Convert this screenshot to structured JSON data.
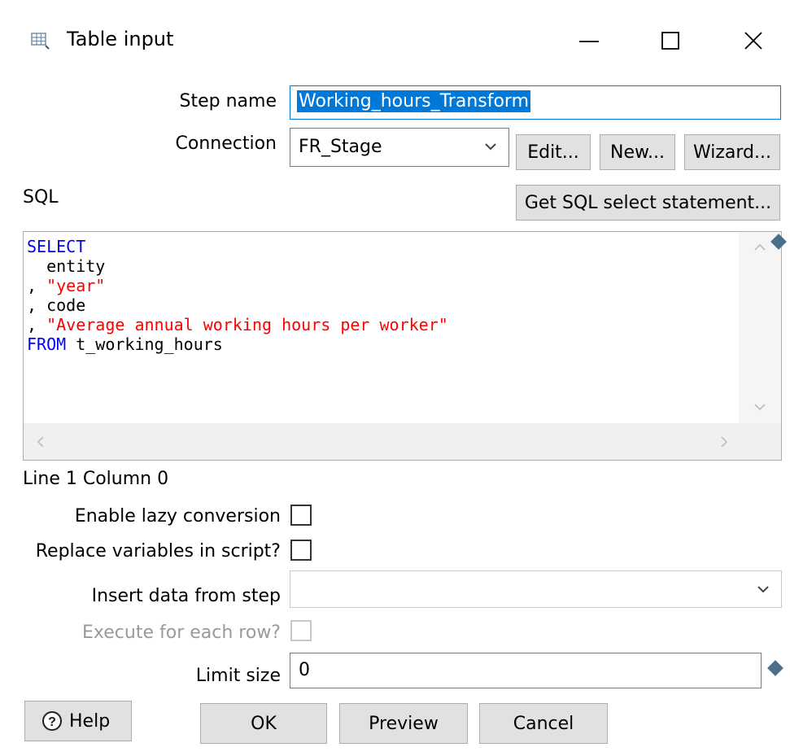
{
  "window": {
    "title": "Table input",
    "minimize_glyph": "—",
    "maximize_glyph": "☐",
    "close_glyph": "✕"
  },
  "step_name": {
    "label": "Step name",
    "value": "Working_hours_Transform"
  },
  "connection": {
    "label": "Connection",
    "value": "FR_Stage"
  },
  "buttons": {
    "edit": "Edit...",
    "new": "New...",
    "wizard": "Wizard...",
    "get_sql": "Get SQL select statement...",
    "help": "Help",
    "ok": "OK",
    "preview": "Preview",
    "cancel": "Cancel"
  },
  "sql": {
    "label": "SQL",
    "lines": [
      {
        "prefix": "",
        "text": "SELECT",
        "kind": "keyword"
      },
      {
        "prefix": "",
        "text": "  entity",
        "kind": "plain"
      },
      {
        "prefix": ",",
        "text": " \"year\"",
        "kind": "string"
      },
      {
        "prefix": ",",
        "text": " code",
        "kind": "plain"
      },
      {
        "prefix": ",",
        "text": " \"Average annual working hours per worker\"",
        "kind": "string"
      },
      {
        "prefix": "",
        "text": "FROM",
        "kind": "keyword",
        "rest": " t_working_hours"
      }
    ]
  },
  "status": "Line 1 Column 0",
  "options": {
    "lazy_conversion": {
      "label": "Enable lazy conversion",
      "checked": false
    },
    "replace_variables": {
      "label": "Replace variables in script?",
      "checked": false
    },
    "insert_from_step": {
      "label": "Insert data from step",
      "value": ""
    },
    "execute_each_row": {
      "label": "Execute for each row?",
      "checked": false,
      "enabled": false
    },
    "limit_size": {
      "label": "Limit size",
      "value": "0"
    }
  },
  "colors": {
    "keyword": "#0000ff",
    "string": "#ff0000",
    "selection": "#0078d7",
    "button_bg": "#e1e1e1",
    "variable_diamond": "#4a6f8a"
  }
}
